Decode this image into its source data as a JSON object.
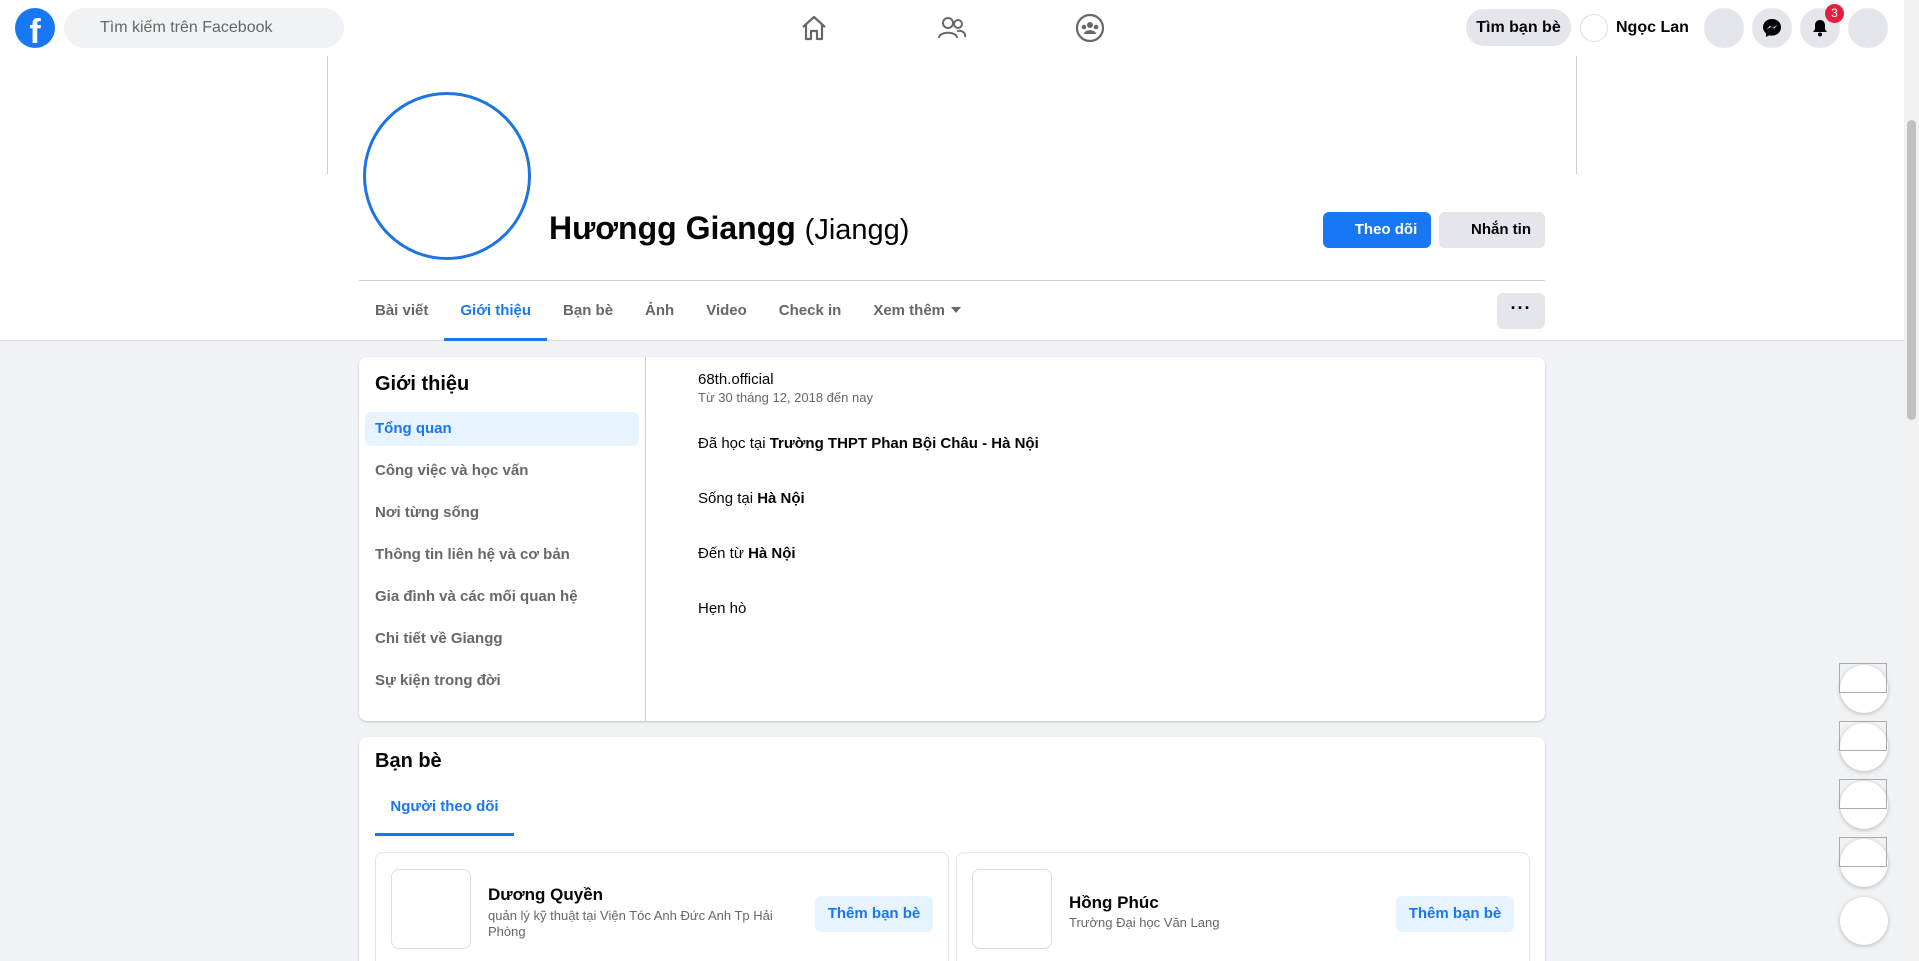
{
  "topbar": {
    "search_placeholder": "Tìm kiếm trên Facebook",
    "find_friends": "Tìm bạn bè",
    "user_name": "Ngọc Lan",
    "notification_count": "3"
  },
  "profile": {
    "name": "Hươngg Giangg",
    "alt_name": "(Jiangg)",
    "follow_label": "Theo dõi",
    "message_label": "Nhắn tin",
    "more_label": "···"
  },
  "tabs": [
    "Bài viết",
    "Giới thiệu",
    "Bạn bè",
    "Ảnh",
    "Video",
    "Check in",
    "Xem thêm"
  ],
  "about": {
    "title": "Giới thiệu",
    "menu": [
      "Tổng quan",
      "Công việc và học vấn",
      "Nơi từng sống",
      "Thông tin liên hệ và cơ bản",
      "Gia đình và các mối quan hệ",
      "Chi tiết về Giangg",
      "Sự kiện trong đời"
    ],
    "work": "68th.official",
    "work_since": "Từ 30 tháng 12, 2018 đến nay",
    "study_prefix": "Đã học tại ",
    "study_school": "Trường THPT Phan Bội Châu - Hà Nội",
    "lives_prefix": "Sống tại ",
    "lives_place": "Hà Nội",
    "from_prefix": "Đến từ ",
    "from_place": "Hà Nội",
    "dating": "Hẹn hò"
  },
  "friends": {
    "title": "Bạn bè",
    "tab": "Người theo dõi",
    "people": [
      {
        "name": "Dương Quyền",
        "desc": "quản lý kỹ thuật tại Viện Tóc Anh Đức Anh Tp Hải Phòng",
        "add": "Thêm bạn bè"
      },
      {
        "name": "Hồng Phúc",
        "desc": "Trường Đại học Văn Lang",
        "add": "Thêm bạn bè"
      }
    ]
  },
  "colors": {
    "accent": "#1877f2",
    "badge": "#e41e3f",
    "background": "#f0f2f5"
  },
  "icons": {
    "logo": "facebook-logo",
    "home": "home-icon",
    "friends": "friends-icon",
    "groups": "groups-icon",
    "messenger": "messenger-icon",
    "bell": "bell-icon"
  }
}
